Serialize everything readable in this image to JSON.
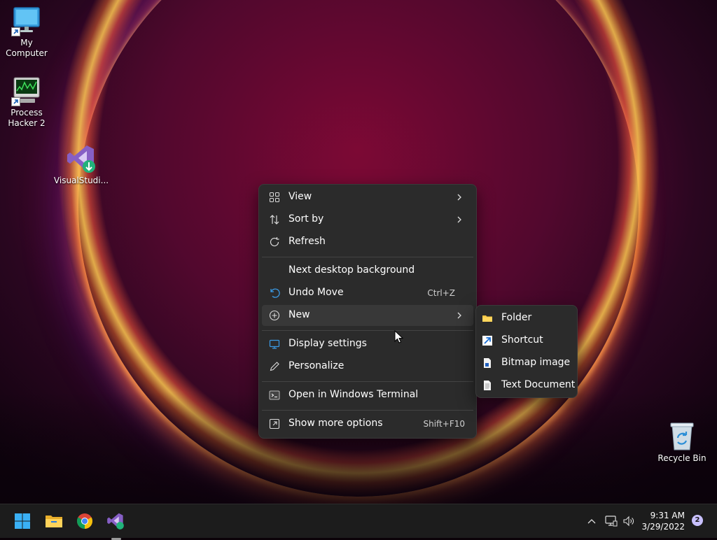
{
  "desktop": {
    "icons": [
      {
        "label": "My Computer",
        "icon": "monitor-icon"
      },
      {
        "label": "Process\nHacker 2",
        "icon": "process-hacker-icon"
      },
      {
        "label": "VisualStudi...",
        "icon": "visual-studio-icon"
      },
      {
        "label": "Recycle Bin",
        "icon": "recycle-bin-icon"
      }
    ]
  },
  "context_menu": {
    "items": [
      {
        "label": "View",
        "icon": "grid-icon",
        "submenu": true
      },
      {
        "label": "Sort by",
        "icon": "sort-icon",
        "submenu": true
      },
      {
        "label": "Refresh",
        "icon": "refresh-icon"
      },
      {
        "label": "Next desktop background",
        "icon": ""
      },
      {
        "label": "Undo Move",
        "icon": "undo-icon",
        "shortcut": "Ctrl+Z"
      },
      {
        "label": "New",
        "icon": "plus-circle-icon",
        "submenu": true,
        "highlighted": true
      },
      {
        "label": "Display settings",
        "icon": "display-icon"
      },
      {
        "label": "Personalize",
        "icon": "pen-icon"
      },
      {
        "label": "Open in Windows Terminal",
        "icon": "terminal-icon"
      },
      {
        "label": "Show more options",
        "icon": "open-external-icon",
        "shortcut": "Shift+F10"
      }
    ]
  },
  "new_submenu": {
    "items": [
      {
        "label": "Folder",
        "icon": "folder-icon"
      },
      {
        "label": "Shortcut",
        "icon": "shortcut-icon"
      },
      {
        "label": "Bitmap image",
        "icon": "bitmap-icon"
      },
      {
        "label": "Text Document",
        "icon": "text-document-icon"
      }
    ]
  },
  "taskbar": {
    "apps": [
      {
        "name": "Start",
        "icon": "windows-start-icon"
      },
      {
        "name": "File Explorer",
        "icon": "folder-icon"
      },
      {
        "name": "Google Chrome",
        "icon": "chrome-icon"
      },
      {
        "name": "Visual Studio Installer",
        "icon": "visual-studio-icon",
        "running": true
      }
    ],
    "tray": {
      "time": "9:31 AM",
      "date": "3/29/2022",
      "notification_count": "2"
    }
  },
  "colors": {
    "menu_bg": "#2b2b2b",
    "menu_hover": "#383838",
    "taskbar_bg": "#1c1c1c",
    "accent": "#0078d4"
  }
}
